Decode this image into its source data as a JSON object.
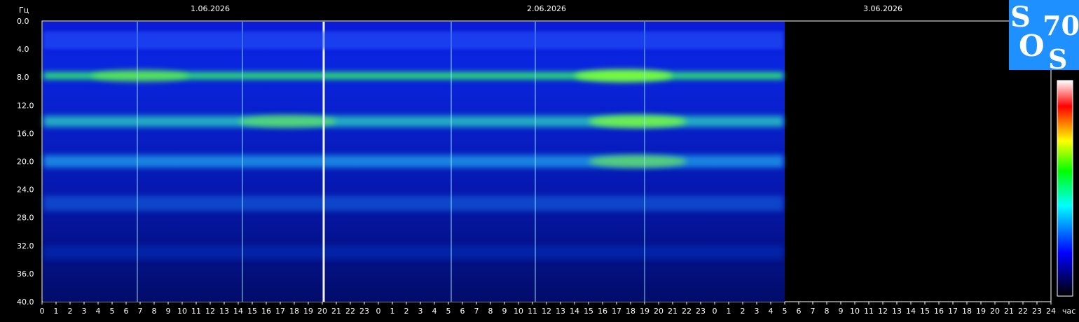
{
  "chart_data": {
    "type": "heatmap",
    "title": "",
    "y_unit_label": "Гц",
    "x_unit_label": "час",
    "date_labels": [
      "1.06.2026",
      "2.06.2026",
      "3.06.2026"
    ],
    "ylim": [
      0,
      40
    ],
    "y_ticks": [
      "0.0",
      "4.0",
      "8.0",
      "12.0",
      "16.0",
      "20.0",
      "24.0",
      "28.0",
      "32.0",
      "36.0",
      "40.0"
    ],
    "x_tick_labels": [
      "0",
      "1",
      "2",
      "3",
      "4",
      "5",
      "6",
      "7",
      "8",
      "9",
      "10",
      "11",
      "12",
      "13",
      "14",
      "15",
      "16",
      "17",
      "18",
      "19",
      "20",
      "21",
      "22",
      "23",
      "0",
      "1",
      "2",
      "3",
      "4",
      "5",
      "6",
      "7",
      "8",
      "9",
      "10",
      "11",
      "12",
      "13",
      "14",
      "15",
      "16",
      "17",
      "18",
      "19",
      "20",
      "21",
      "22",
      "23",
      "0",
      "1",
      "2",
      "3",
      "4",
      "5",
      "6",
      "7",
      "8",
      "9",
      "10",
      "11",
      "12",
      "13",
      "14",
      "15",
      "16",
      "17",
      "18",
      "19",
      "20",
      "21",
      "22",
      "23",
      "24"
    ],
    "data_end_hours": 53,
    "resonance_bands_hz": [
      7.8,
      14.3,
      20.0,
      26.0,
      33.0
    ],
    "colorscale": [
      "#000000",
      "#0000ff",
      "#00ffff",
      "#00ff00",
      "#ffff00",
      "#ff0000",
      "#ffffff"
    ],
    "spikes_hours": [
      20.1,
      29.2,
      35.2,
      43.0,
      6.8,
      14.3
    ]
  },
  "logo": {
    "letters": [
      "S",
      "70",
      "O",
      "S"
    ],
    "color": "#1e90ff"
  }
}
